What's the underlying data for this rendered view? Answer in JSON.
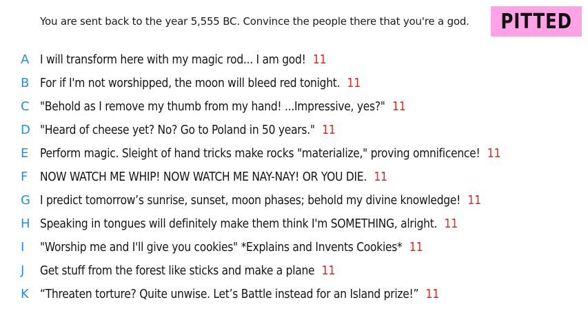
{
  "prompt": "You are sent back to the year 5,555 BC. Convince the people there that you're a god.",
  "badge": {
    "label": "PITTED",
    "color": "#ffa3e6"
  },
  "colors": {
    "letter": "#1f8fe0",
    "score": "#e8201a",
    "text": "#141414"
  },
  "answers": [
    {
      "letter": "A",
      "text": "I will transform here with my magic rod... I am god!",
      "score": "11"
    },
    {
      "letter": "B",
      "text": "For if I'm not worshipped, the moon will bleed red tonight.",
      "score": "11"
    },
    {
      "letter": "C",
      "text": "\"Behold as I remove my thumb from my hand! ...Impressive, yes?\"",
      "score": "11"
    },
    {
      "letter": "D",
      "text": "\"Heard of cheese yet? No? Go to Poland in 50 years.\"",
      "score": "11"
    },
    {
      "letter": "E",
      "text": "Perform magic. Sleight of hand tricks make rocks \"materialize,\" proving omnificence!",
      "score": "11"
    },
    {
      "letter": "F",
      "text": "NOW WATCH ME WHIP! NOW WATCH ME NAY-NAY! OR YOU DIE.",
      "score": "11"
    },
    {
      "letter": "G",
      "text": "I predict tomorrow’s sunrise, sunset, moon phases; behold my divine knowledge!",
      "score": "11"
    },
    {
      "letter": "H",
      "text": "Speaking in tongues will definitely make them think I'm SOMETHING, alright.",
      "score": "11"
    },
    {
      "letter": "I",
      "text": "\"Worship me and I'll give you cookies\" *Explains and Invents Cookies*",
      "score": "11"
    },
    {
      "letter": "J",
      "text": "Get stuff from the forest like sticks and make a plane",
      "score": "11"
    },
    {
      "letter": "K",
      "text": "“Threaten torture? Quite unwise. Let’s Battle instead for an Island prize!”",
      "score": "11"
    }
  ]
}
